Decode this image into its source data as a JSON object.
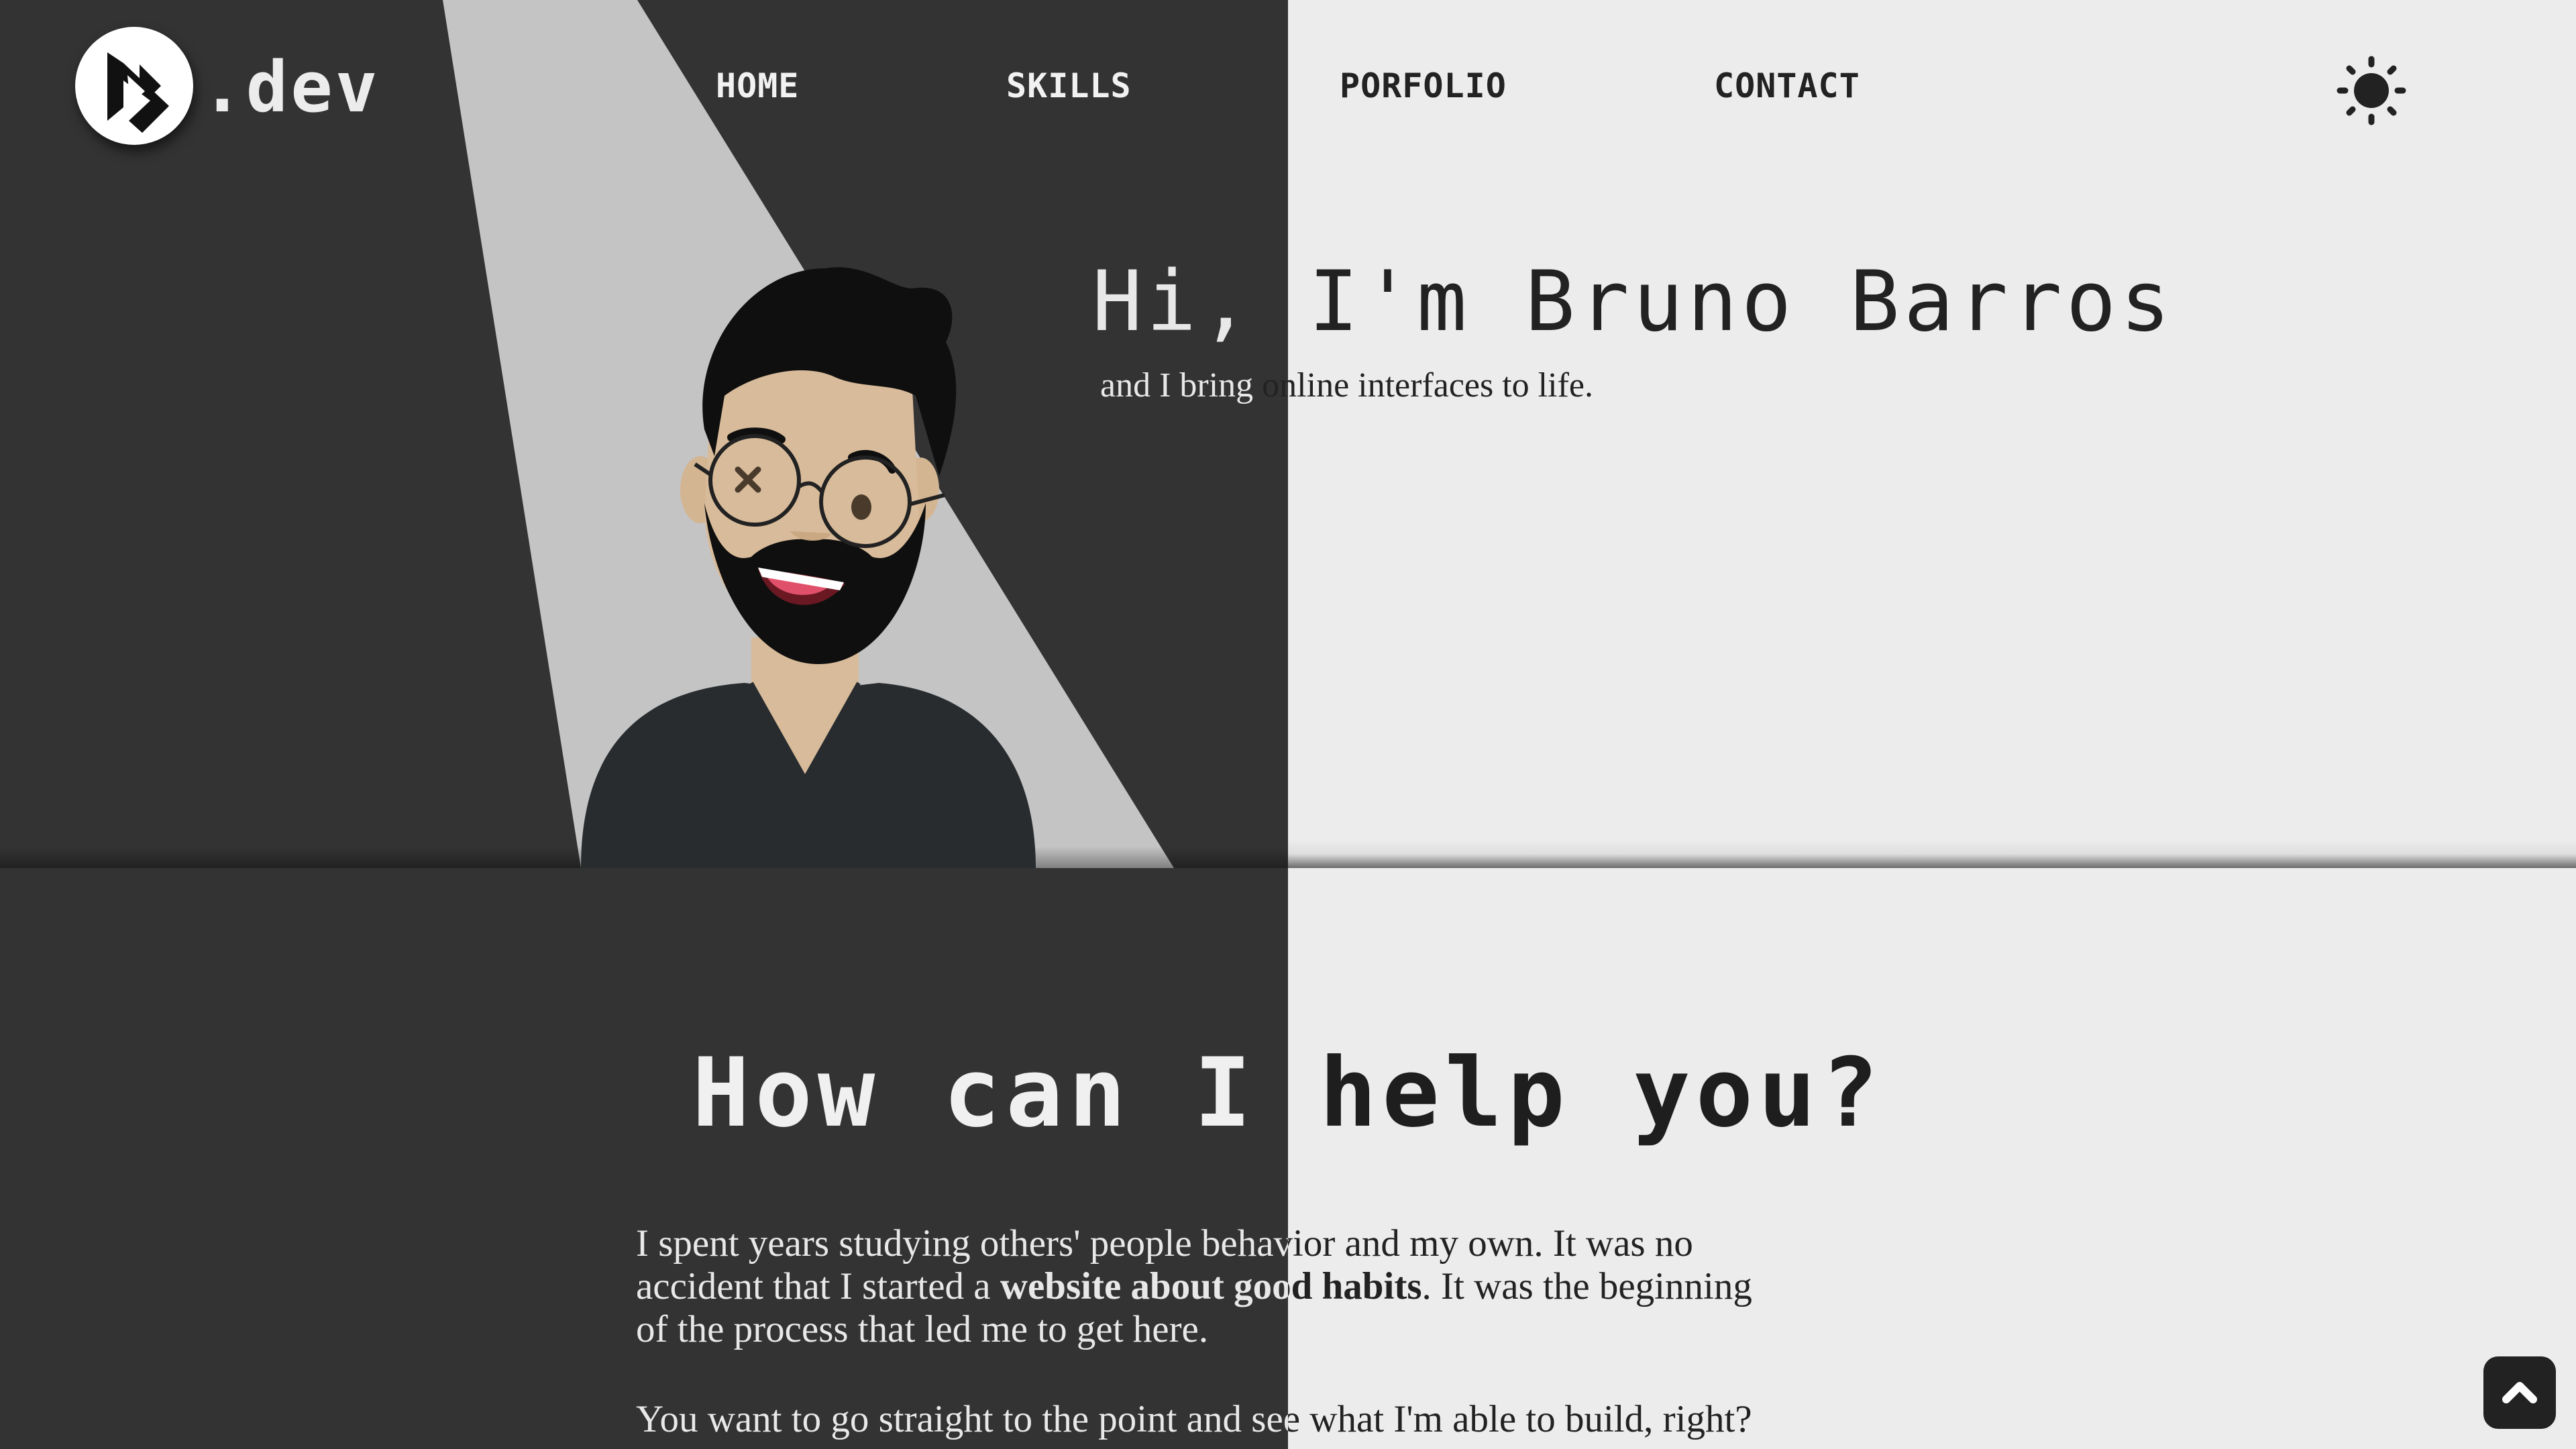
{
  "header": {
    "logo_text": ".dev",
    "nav": [
      {
        "label": "HOME"
      },
      {
        "label": "SKILLS"
      },
      {
        "label": "PORFOLIO"
      },
      {
        "label": "CONTACT"
      }
    ],
    "theme_icon": "sun-icon"
  },
  "hero": {
    "title": "Hi, I'm Bruno Barros",
    "title_part1": "Hi, ",
    "title_part2": "I'm Bruno Barros",
    "subtitle_part1": "and I bring ",
    "subtitle_part2": "online interfaces to life."
  },
  "help": {
    "title_part1": "How can I ",
    "title_part2": "help you?",
    "para1_line1": "I spent years studying others' people behavior and my own. It was no",
    "para1_line2_a": "accident that I started a ",
    "para1_line2_bold": "website about good habits",
    "para1_line2_b": ". It was the beginning",
    "para1_line3": "of the process that led me to get here.",
    "para2": "You want to go straight to the point and see what I'm able to build, right?"
  },
  "back_to_top_icon": "chevron-up-icon",
  "colors": {
    "dark_half": "#333333",
    "light_half": "#ececec",
    "spotlight": "#c4c4c4",
    "shirt": "#282c2f",
    "skin": "#d8bb9a",
    "hair": "#0f0f0f"
  }
}
